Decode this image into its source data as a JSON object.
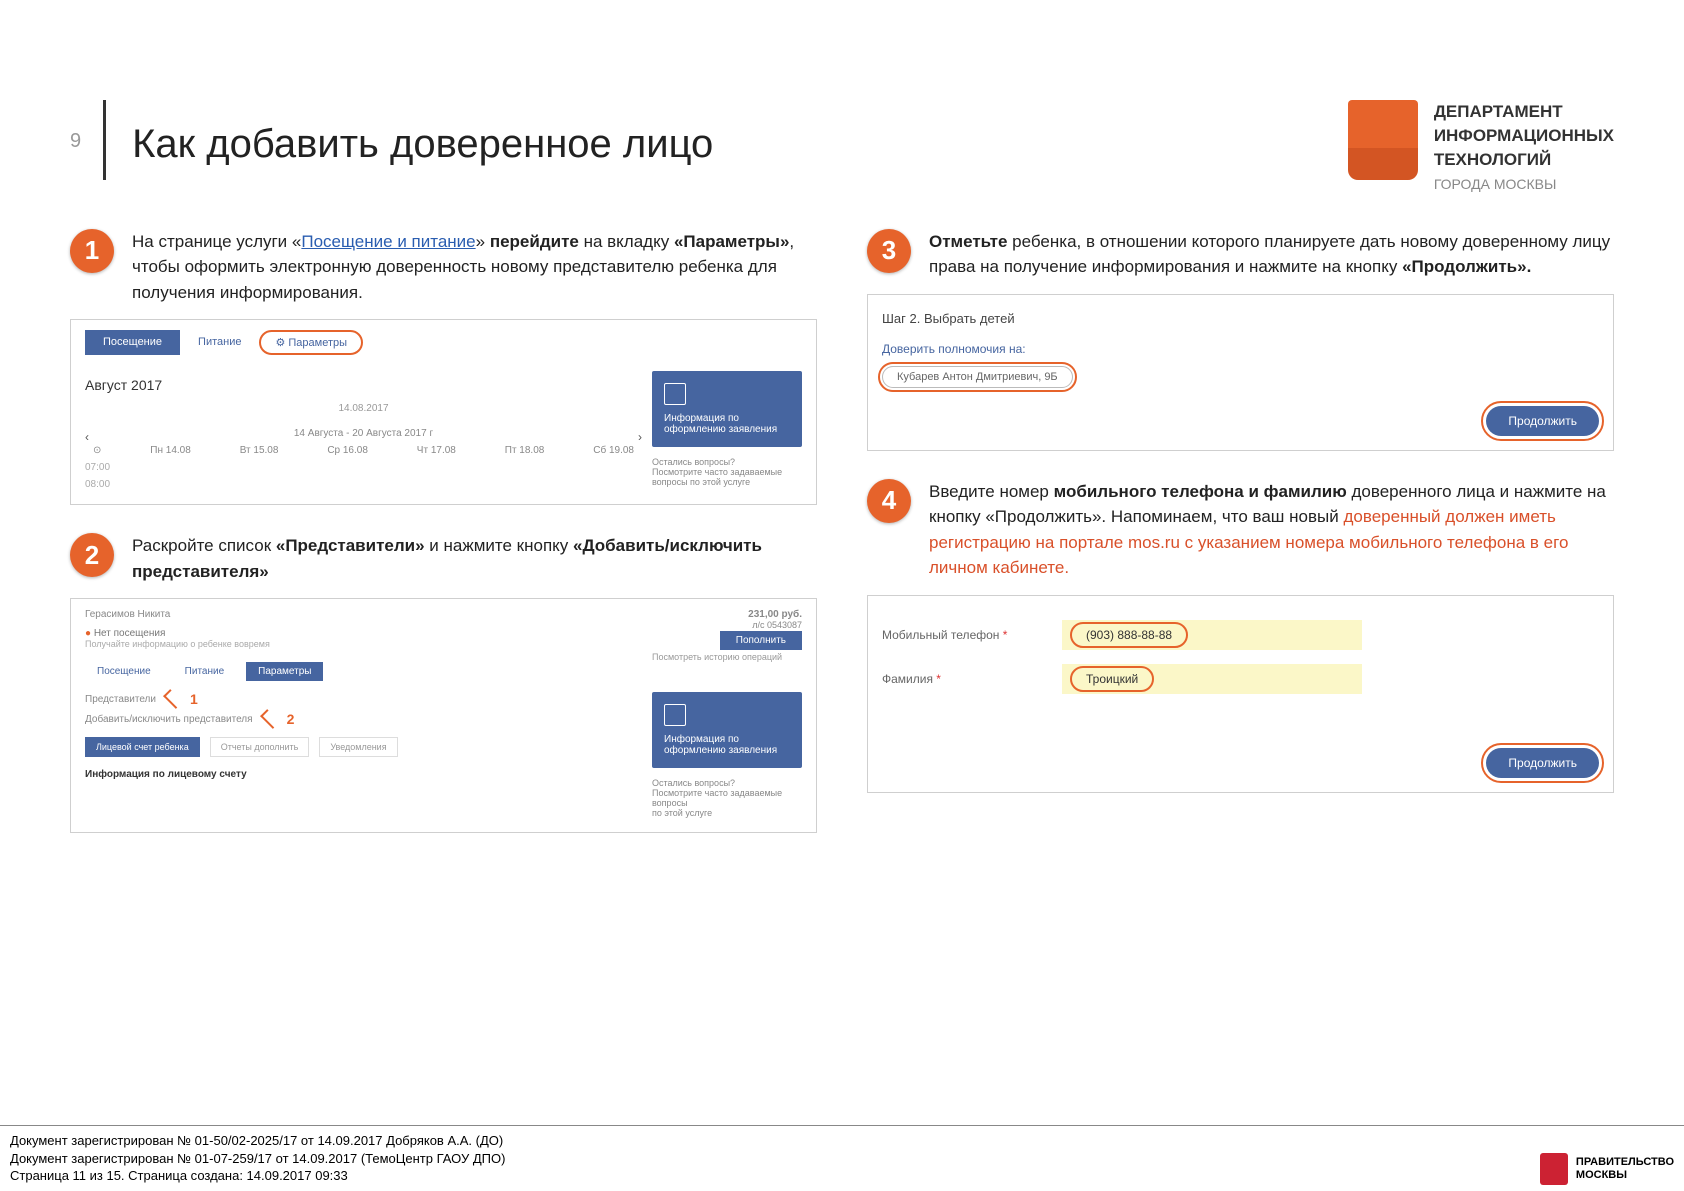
{
  "page_number": "9",
  "title": "Как добавить доверенное лицо",
  "dept": {
    "line1": "ДЕПАРТАМЕНТ",
    "line2": "ИНФОРМАЦИОННЫХ",
    "line3": "ТЕХНОЛОГИЙ",
    "city": "ГОРОДА МОСКВЫ"
  },
  "step1": {
    "num": "1",
    "text_before": "На странице услуги «",
    "link": "Посещение и питание",
    "text_mid1": "» ",
    "bold1": "перейдите",
    "text_mid2": " на вкладку ",
    "bold2": "«Параметры»",
    "text_after": ", чтобы оформить электронную доверенность новому представителю ребенка для получения информирования.",
    "tabs": {
      "t1": "Посещение",
      "t2": "Питание",
      "t3": "⚙ Параметры"
    },
    "month": "Август 2017",
    "date_sel": "14.08.2017",
    "range": "14 Августа - 20 Августа 2017 г",
    "days": {
      "d0": "⊙",
      "d1": "Пн 14.08",
      "d2": "Вт 15.08",
      "d3": "Ср 16.08",
      "d4": "Чт 17.08",
      "d5": "Пт 18.08",
      "d6": "Сб 19.08"
    },
    "h1": "07:00",
    "h2": "08:00",
    "card": "Информация по оформлению заявления",
    "note1": "Остались вопросы?",
    "note2": "Посмотрите часто задаваемые",
    "note3": "вопросы по этой услуге"
  },
  "step2": {
    "num": "2",
    "text1": "Раскройте список ",
    "bold1": "«Представители»",
    "text2": " и нажмите кнопку ",
    "bold2": "«Добавить/исключить представителя»",
    "student": "Герасимов Никита",
    "amount": "231,00 руб.",
    "amount_sub": "л/с 0543087",
    "btn_top": "Пополнить",
    "opt1": "Нет посещения",
    "opt1_sub": "Получайте информацию о ребенке вовремя",
    "opt2": "Посмотреть историю операций",
    "tab1": "Посещение",
    "tab2": "Питание",
    "tab3": "Параметры",
    "rep": "Представители",
    "add_rep": "Добавить/исключить представителя",
    "a1": "1",
    "a2": "2",
    "pill1": "Лицевой счет ребенка",
    "pill2": "Отчеты дополнить",
    "pill3": "Уведомления",
    "info": "Информация по лицевому счету",
    "card": "Информация по оформлению заявления",
    "note1": "Остались вопросы?",
    "note2": "Посмотрите часто задаваемые вопросы",
    "note3": "по этой услуге"
  },
  "step3": {
    "num": "3",
    "bold1": "Отметьте",
    "text1": " ребенка, в отношении которого планируете дать новому доверенному лицу права на получение информирования и нажмите на кнопку ",
    "bold2": "«Продолжить».",
    "title": "Шаг 2. Выбрать детей",
    "sub": "Доверить полномочия на:",
    "chip": "Кубарев Антон Дмитриевич, 9Б",
    "btn": "Продолжить"
  },
  "step4": {
    "num": "4",
    "text1": "Введите номер ",
    "bold1": "мобильного телефона и фамилию",
    "text2": " доверенного лица и нажмите на кнопку «Продолжить». Напоминаем, что ваш новый ",
    "warn": "доверенный должен иметь регистрацию на портале mos.ru с указанием номера мобильного телефона в его личном кабинете.",
    "lbl_phone": "Мобильный телефон",
    "req": "*",
    "val_phone": "(903) 888-88-88",
    "lbl_surname": "Фамилия",
    "val_surname": "Троицкий",
    "btn": "Продолжить"
  },
  "footer": {
    "l1": "Документ зарегистрирован № 01-50/02-2025/17 от 14.09.2017 Добряков А.А. (ДО)",
    "l2": "Документ зарегистрирован № 01-07-259/17 от 14.09.2017  (ТемоЦентр ГАОУ ДПО)",
    "l3": "Страница 11 из 15. Страница создана: 14.09.2017 09:33",
    "gov1": "ПРАВИТЕЛЬСТВО",
    "gov2": "МОСКВЫ"
  }
}
